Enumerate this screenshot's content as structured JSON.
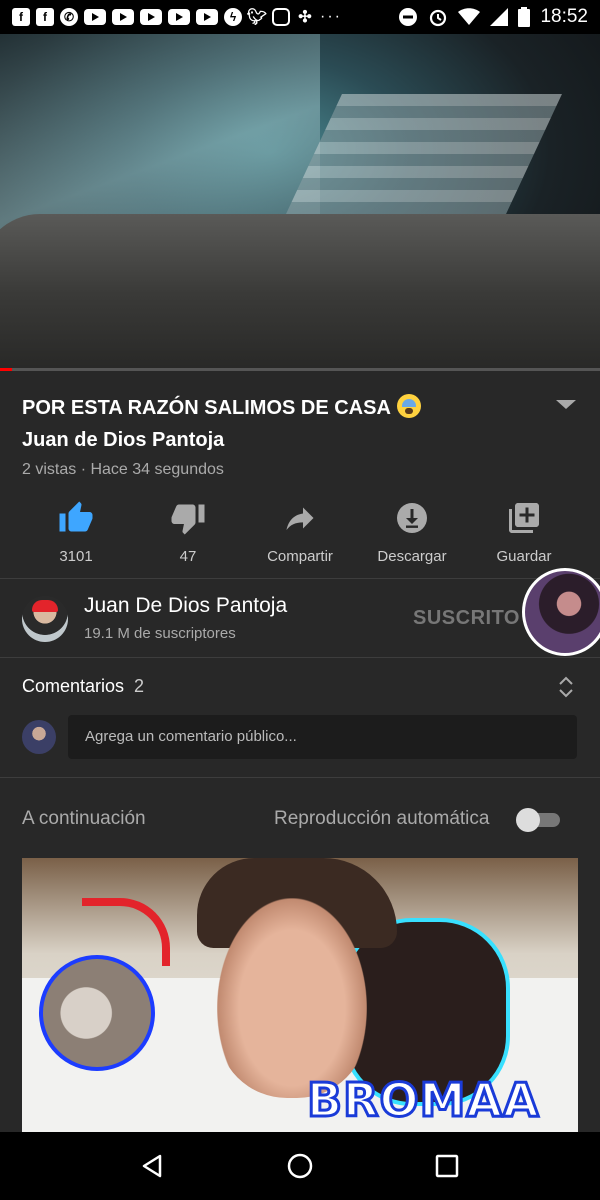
{
  "status_bar": {
    "time": "18:52",
    "notification_icons": [
      "facebook-icon",
      "facebook-icon",
      "whatsapp-icon",
      "youtube-icon",
      "youtube-icon",
      "youtube-icon",
      "youtube-icon",
      "youtube-icon",
      "messenger-icon",
      "twitter-icon",
      "instagram-icon",
      "pinwheel-icon"
    ],
    "more": "···"
  },
  "video": {
    "progress_fraction": 0.02
  },
  "video_info": {
    "title_line1": "POR ESTA RAZÓN SALIMOS DE CASA",
    "title_line2": "Juan de Dios Pantoja",
    "meta": "2 vistas · Hace 34 segundos"
  },
  "actions": [
    {
      "name": "like",
      "label": "3101",
      "icon": "thumbs-up-icon",
      "active": true
    },
    {
      "name": "dislike",
      "label": "47",
      "icon": "thumbs-down-icon"
    },
    {
      "name": "share",
      "label": "Compartir",
      "icon": "share-icon"
    },
    {
      "name": "download",
      "label": "Descargar",
      "icon": "download-icon"
    },
    {
      "name": "save",
      "label": "Guardar",
      "icon": "add-to-playlist-icon"
    }
  ],
  "channel": {
    "name": "Juan De Dios Pantoja",
    "subscribers": "19.1 M de suscriptores",
    "subscribe_label": "SUSCRITO"
  },
  "comments": {
    "heading": "Comentarios",
    "count": "2",
    "placeholder": "Agrega un comentario público..."
  },
  "up_next": {
    "label": "A continuación",
    "autoplay_label": "Reproducción automática",
    "autoplay_on": false,
    "thumbnail_text": "BROMAA"
  },
  "colors": {
    "background": "#282828",
    "accent_like": "#3ea6ff",
    "progress": "#ff0000"
  }
}
